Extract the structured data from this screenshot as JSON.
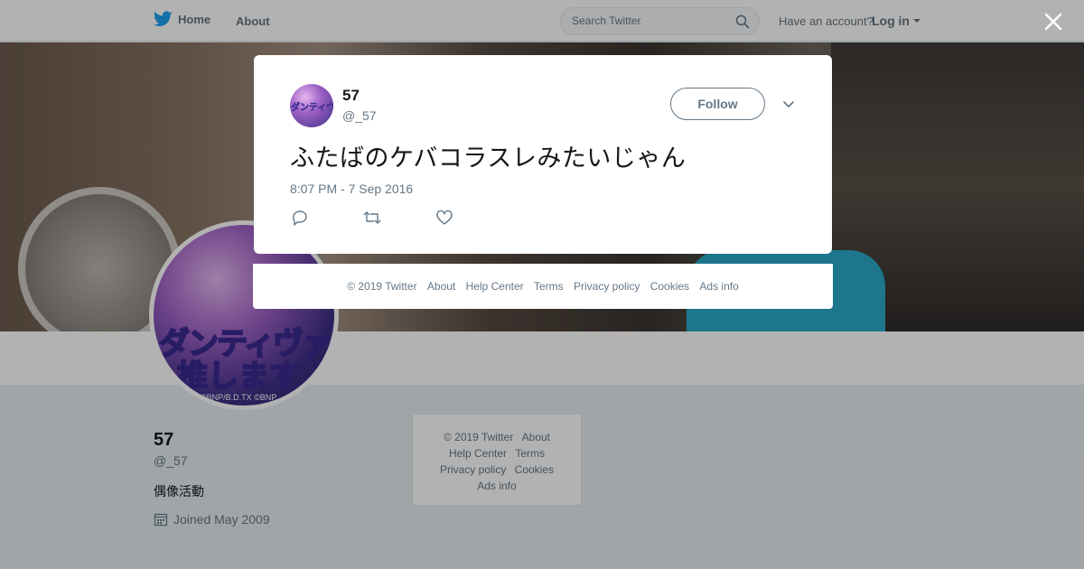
{
  "topnav": {
    "home_label": "Home",
    "about_label": "About",
    "search_placeholder": "Search Twitter",
    "have_account": "Have an account?",
    "login_label": "Log in"
  },
  "avatar": {
    "text_line1": "ダンティヴァを",
    "text_line2": "推します",
    "copyright": "©BNP/B.D.TX ©BNP"
  },
  "profile": {
    "name": "57",
    "handle": "@_57",
    "bio": "偶像活動",
    "joined": "Joined May 2009"
  },
  "side_footer": {
    "links": [
      "© 2019 Twitter",
      "About",
      "Help Center",
      "Terms",
      "Privacy policy",
      "Cookies",
      "Ads info"
    ]
  },
  "modal": {
    "avatar_text": "ダンティヴァを",
    "name": "57",
    "handle": "@_57",
    "follow_label": "Follow",
    "tweet_text": "ふたばのケバコラスレみたいじゃん",
    "timestamp": "8:07 PM - 7 Sep 2016",
    "actions": [
      "reply-icon",
      "retweet-icon",
      "like-icon"
    ]
  },
  "modal_footer": {
    "links": [
      "© 2019 Twitter",
      "About",
      "Help Center",
      "Terms",
      "Privacy policy",
      "Cookies",
      "Ads info"
    ]
  },
  "colors": {
    "twitter_blue": "#1da1f2",
    "text_primary": "#14171a",
    "text_secondary": "#657786",
    "page_bg": "#e6ecf0"
  }
}
